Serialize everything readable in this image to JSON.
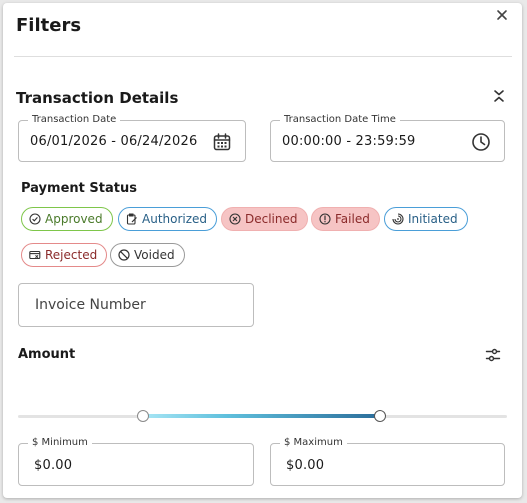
{
  "header": {
    "title": "Filters",
    "close_icon": "close-icon"
  },
  "transaction_details": {
    "title": "Transaction Details",
    "date": {
      "label": "Transaction Date",
      "value": "06/01/2026 - 06/24/2026",
      "icon": "calendar-icon"
    },
    "time": {
      "label": "Transaction Date Time",
      "value": "00:00:00 - 23:59:59",
      "icon": "clock-icon"
    }
  },
  "payment_status": {
    "title": "Payment Status",
    "chips": [
      {
        "label": "Approved",
        "icon": "check-circle-icon",
        "color": "#7ec64a"
      },
      {
        "label": "Authorized",
        "icon": "clipboard-edit-icon",
        "color": "#4a9ed8"
      },
      {
        "label": "Declined",
        "icon": "x-circle-icon",
        "color": "#f6c4c4"
      },
      {
        "label": "Failed",
        "icon": "alert-circle-icon",
        "color": "#f6c4c4"
      },
      {
        "label": "Initiated",
        "icon": "progress-icon",
        "color": "#4a9ed8"
      },
      {
        "label": "Rejected",
        "icon": "card-x-icon",
        "color": "#e48a8a"
      },
      {
        "label": "Voided",
        "icon": "ban-icon",
        "color": "#9a9a9a"
      }
    ]
  },
  "invoice": {
    "placeholder": "Invoice Number"
  },
  "amount": {
    "title": "Amount",
    "minimum": {
      "label": "$ Minimum",
      "value": "$0.00"
    },
    "maximum": {
      "label": "$ Maximum",
      "value": "$0.00"
    }
  }
}
